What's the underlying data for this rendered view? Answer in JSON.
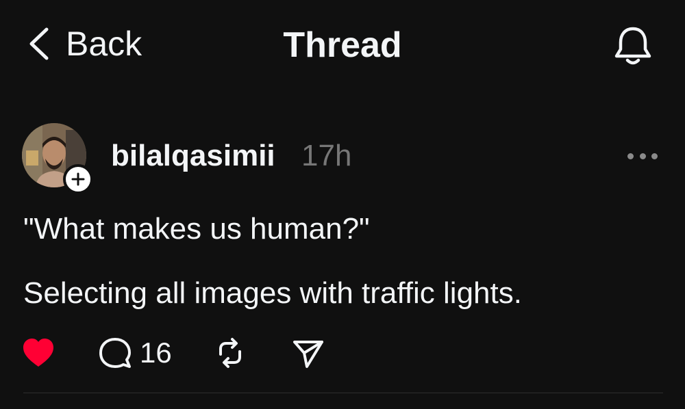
{
  "nav": {
    "back_label": "Back",
    "title": "Thread",
    "back_icon": "chevron-left-icon",
    "bell_icon": "bell-icon"
  },
  "post": {
    "username": "bilalqasimii",
    "timestamp": "17h",
    "lines": [
      "\"What makes us human?\"",
      "Selecting all images with traffic lights."
    ],
    "liked": true,
    "reply_count": "16"
  },
  "colors": {
    "background": "#101010",
    "text": "#f3f5f7",
    "muted": "#777777",
    "like": "#ff0034"
  }
}
